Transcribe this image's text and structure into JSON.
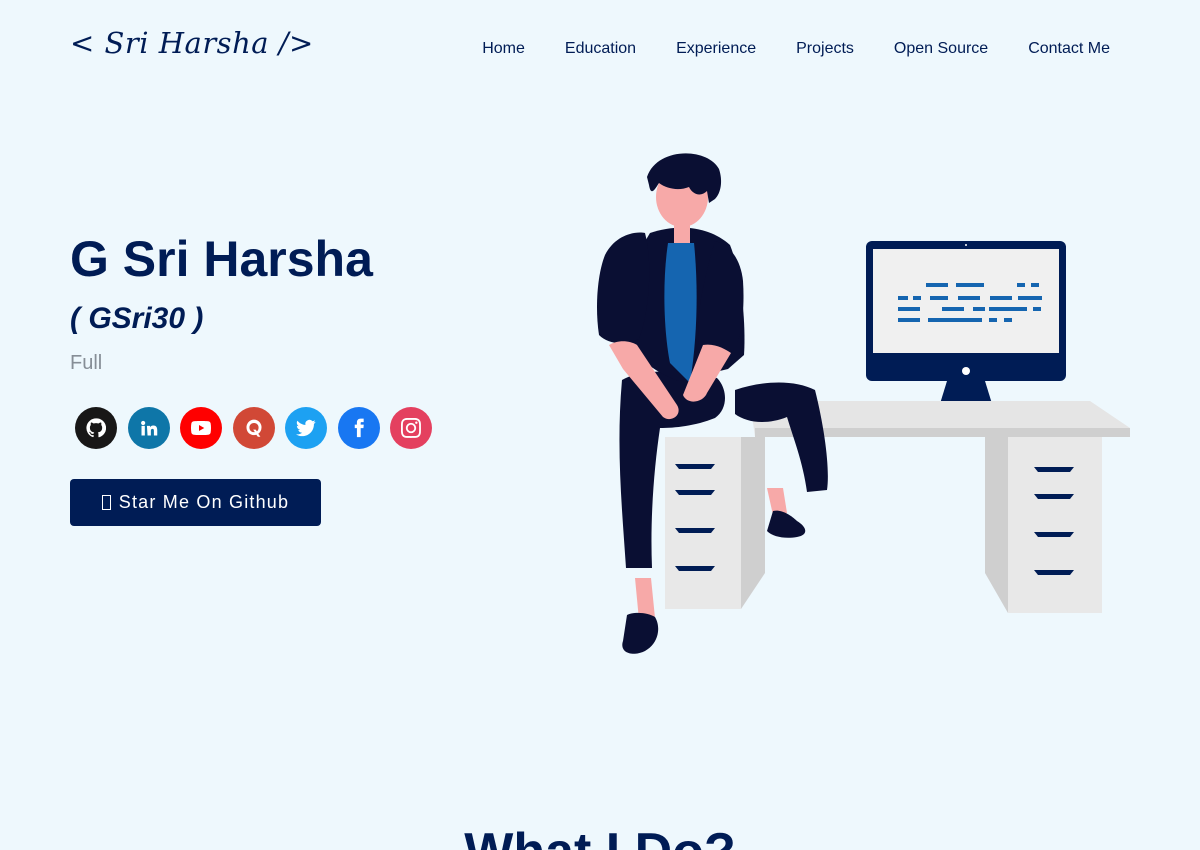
{
  "header": {
    "logo": "< Sri Harsha />",
    "nav": [
      "Home",
      "Education",
      "Experience",
      "Projects",
      "Open Source",
      "Contact Me"
    ]
  },
  "hero": {
    "name": "G Sri Harsha",
    "handle": "( GSri30 )",
    "subtitle": "Full",
    "cta_label": "Star Me On Github"
  },
  "socials": [
    {
      "name": "github",
      "color": "#181717"
    },
    {
      "name": "linkedin",
      "color": "#0e76a8"
    },
    {
      "name": "youtube",
      "color": "#ff0000"
    },
    {
      "name": "quora",
      "color": "#d14836"
    },
    {
      "name": "twitter",
      "color": "#1da1f2"
    },
    {
      "name": "facebook",
      "color": "#1877f2"
    },
    {
      "name": "instagram",
      "color": "#e4405f"
    }
  ],
  "next_section": {
    "title": "What I Do?"
  },
  "colors": {
    "background": "#eef8fd",
    "primary": "#001c55",
    "subtitle": "#868e96"
  }
}
